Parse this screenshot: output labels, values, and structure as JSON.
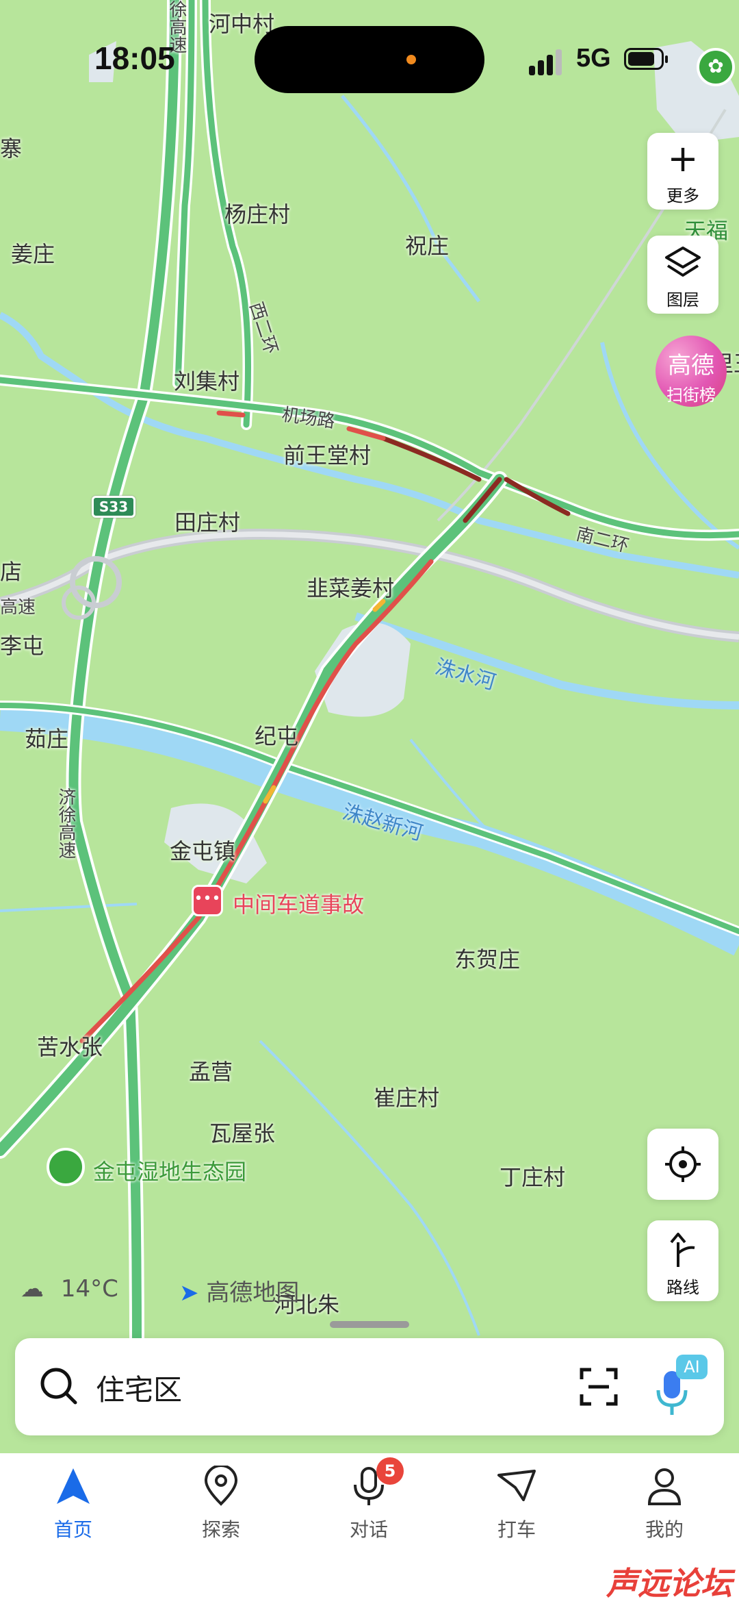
{
  "status_bar": {
    "time": "18:05",
    "network": "5G"
  },
  "map": {
    "places": [
      "河中村",
      "寨",
      "杨庄村",
      "姜庄",
      "祝庄",
      "刘集村",
      "前王堂村",
      "田庄村",
      "韭菜姜村",
      "店",
      "李屯",
      "纪屯",
      "茹庄",
      "金屯镇",
      "东贺庄",
      "苦水张",
      "孟营",
      "崔庄村",
      "瓦屋张",
      "丁庄村",
      "河北朱",
      "天福",
      "里王"
    ],
    "roads": [
      "机场路",
      "南二环",
      "西二环",
      "济徐高速",
      "徐高速",
      "高速"
    ],
    "road_shield": "S33",
    "rivers": [
      "洙水河",
      "洙赵新河"
    ],
    "incident": "中间车道事故",
    "poi": "金屯湿地生态园"
  },
  "controls": {
    "more_label": "更多",
    "layers_label": "图层",
    "rank_title": "高德",
    "rank_sub": "扫街榜",
    "route_label": "路线"
  },
  "info": {
    "weather": "14°C",
    "brand": "高德地图"
  },
  "search": {
    "value": "住宅区",
    "ai_badge": "AI"
  },
  "tabs": [
    {
      "label": "首页",
      "icon": "navigation-arrow-icon",
      "active": true
    },
    {
      "label": "探索",
      "icon": "location-pin-icon"
    },
    {
      "label": "对话",
      "icon": "microphone-icon",
      "badge": "5"
    },
    {
      "label": "打车",
      "icon": "taxi-flag-icon"
    },
    {
      "label": "我的",
      "icon": "person-icon"
    }
  ],
  "watermark": "声远论坛",
  "colors": {
    "map_bg": "#b7e59b",
    "road_green": "#5cc27a",
    "road_red": "#e0504a",
    "road_dark": "#8b2a22",
    "water": "#9fd8f5",
    "accent": "#1a6be8"
  }
}
